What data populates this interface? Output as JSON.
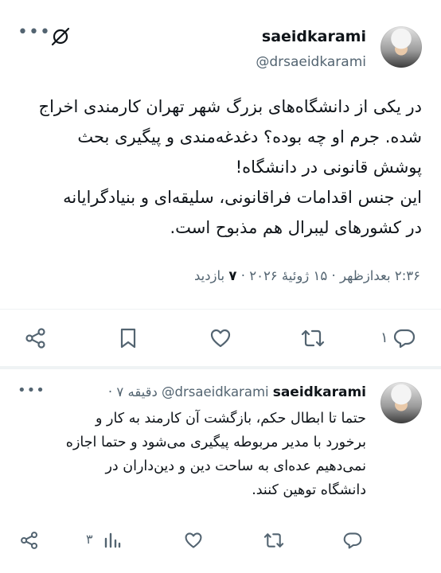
{
  "tweet": {
    "display_name": "saeidkarami",
    "handle": "@drsaeidkarami",
    "lines": [
      "در یکی از دانشگاه‌های بزرگ شهر تهران کارمندی اخراج",
      "شده. جرم او چه بوده؟ دغدغه‌مندی و پیگیری بحث",
      "پوشش قانونی در دانشگاه!",
      "این جنس اقدامات فراقانونی، سلیقه‌ای و بنیادگرایانه",
      "در کشورهای لیبرال هم مذبوح است."
    ],
    "timestamp": "۲:۳۶ بعدازظهر · ۱۵ ژوئیهٔ ۲۰۲۶ ·",
    "views_count": "۷",
    "views_label": "بازدید",
    "reply_count": "۱"
  },
  "reply": {
    "display_name": "saeidkarami",
    "handle": "@drsaeidkarami",
    "time": "· ۷ دقیقه",
    "lines": [
      "حتما تا ابطال حکم، بازگشت آن کارمند به کار و",
      "برخورد با مدیر مربوطه پیگیری می‌شود و حتما اجازه",
      "نمی‌دهیم عده‌ای به ساحت دین و دین‌داران در",
      "دانشگاه توهین کنند."
    ],
    "views_count": "۳"
  },
  "icons": {
    "more": "more-icon",
    "grok": "grok-icon",
    "reply": "reply-icon",
    "retweet": "retweet-icon",
    "like": "like-icon",
    "bookmark": "bookmark-icon",
    "share": "share-icon",
    "views": "views-icon"
  },
  "colors": {
    "text": "#0f1419",
    "secondary": "#536471",
    "divider": "#eff3f4"
  }
}
